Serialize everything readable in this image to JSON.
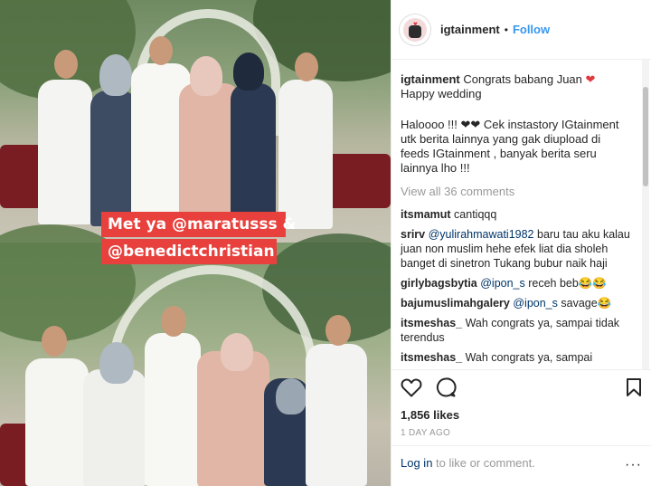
{
  "post": {
    "image_caption_line1": "Met ya @maratusss &",
    "image_caption_line2": "@benedictchristian"
  },
  "header": {
    "username": "igtainment",
    "separator": "•",
    "follow_label": "Follow"
  },
  "caption": {
    "username": "igtainment",
    "line1": " Congrats babang Juan ",
    "heart": "❤",
    "line2": "Happy wedding",
    "para2_start": "Haloooo !!! ",
    "para2_hearts": "❤❤",
    "para2_rest": " Cek instastory IGtainment utk berita lainnya yang gak diupload di feeds IGtainment , banyak berita seru lainnya lho !!!"
  },
  "view_all_label": "View all 36 comments",
  "comments": [
    {
      "user": "itsmamut",
      "pre": " cantiqqq",
      "mention": "",
      "post": ""
    },
    {
      "user": "srirv",
      "pre": " ",
      "mention": "@yulirahmawati1982",
      "post": " baru tau aku kalau juan non muslim hehe efek liat dia sholeh banget di sinetron Tukang bubur naik haji"
    },
    {
      "user": "girlybagsbytia",
      "pre": " ",
      "mention": "@ipon_s",
      "post": " receh beb😂😂"
    },
    {
      "user": "bajumuslimahgalery",
      "pre": " ",
      "mention": "@ipon_s",
      "post": " savage😂"
    },
    {
      "user": "itsmeshas_",
      "pre": " Wah congrats ya, sampai tidak terendus",
      "mention": "",
      "post": ""
    },
    {
      "user": "itsmeshas_",
      "pre": " Wah congrats ya, sampai",
      "mention": "",
      "post": ""
    }
  ],
  "icons": {
    "like": "heart-outline-icon",
    "comment": "comment-bubble-icon",
    "save": "bookmark-icon"
  },
  "likes_label": "1,856 likes",
  "date_label": "1 DAY AGO",
  "login": {
    "link_label": "Log in",
    "rest": " to like or comment.",
    "more": "···"
  },
  "colors": {
    "accent": "#3897f0",
    "link": "#003569",
    "caption_bar": "#e8413d",
    "heart": "#e0393e"
  }
}
